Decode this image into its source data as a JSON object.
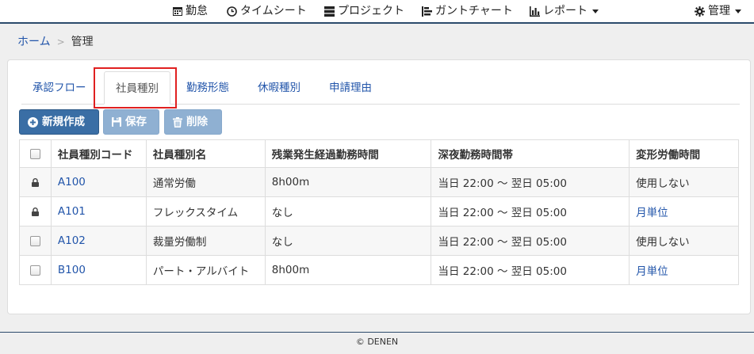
{
  "nav": {
    "items": [
      {
        "label": "勤怠",
        "icon": "calendar-icon"
      },
      {
        "label": "タイムシート",
        "icon": "clock-icon"
      },
      {
        "label": "プロジェクト",
        "icon": "server-icon"
      },
      {
        "label": "ガントチャート",
        "icon": "gantt-icon"
      },
      {
        "label": "レポート",
        "icon": "bar-chart-icon"
      }
    ],
    "admin_label": "管理"
  },
  "breadcrumb": {
    "home": "ホーム",
    "separator": ">",
    "current": "管理"
  },
  "tabs": [
    {
      "label": "承認フロー",
      "active": false
    },
    {
      "label": "社員種別",
      "active": true
    },
    {
      "label": "勤務形態",
      "active": false
    },
    {
      "label": "休暇種別",
      "active": false
    },
    {
      "label": "申請理由",
      "active": false
    }
  ],
  "toolbar": {
    "new_label": "新規作成",
    "save_label": "保存",
    "delete_label": "削除"
  },
  "table": {
    "headers": [
      "社員種別コード",
      "社員種別名",
      "残業発生経過勤務時間",
      "深夜勤務時間帯",
      "変形労働時間"
    ],
    "rows": [
      {
        "locked": true,
        "code": "A100",
        "name": "通常労働",
        "overtime": "8h00m",
        "night": "当日 22:00 〜 翌日 05:00",
        "variable": "使用しない",
        "variable_link": false
      },
      {
        "locked": true,
        "code": "A101",
        "name": "フレックスタイム",
        "overtime": "なし",
        "night": "当日 22:00 〜 翌日 05:00",
        "variable": "月単位",
        "variable_link": true
      },
      {
        "locked": false,
        "code": "A102",
        "name": "裁量労働制",
        "overtime": "なし",
        "night": "当日 22:00 〜 翌日 05:00",
        "variable": "使用しない",
        "variable_link": false
      },
      {
        "locked": false,
        "code": "B100",
        "name": "パート・アルバイト",
        "overtime": "8h00m",
        "night": "当日 22:00 〜 翌日 05:00",
        "variable": "月単位",
        "variable_link": true
      }
    ]
  },
  "footer": {
    "text": "© DENEN"
  },
  "colors": {
    "accent": "#3a6ea5",
    "link": "#2255aa",
    "highlight": "#e02020"
  }
}
